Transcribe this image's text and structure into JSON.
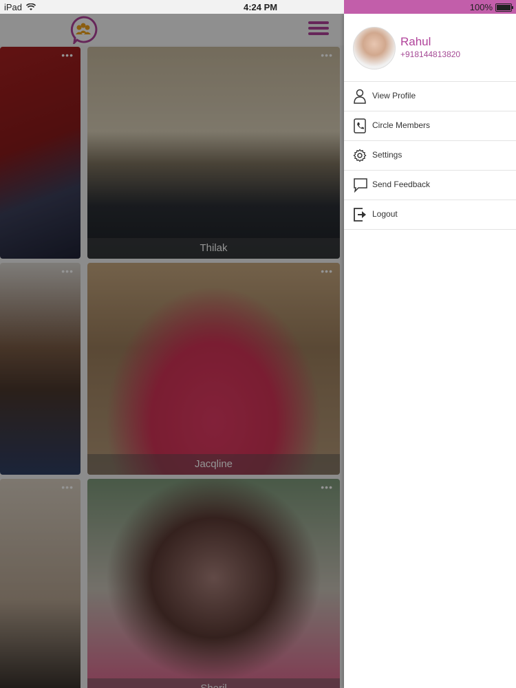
{
  "status_bar": {
    "device": "iPad",
    "time": "4:24 PM",
    "battery": "100%",
    "battery_level": 1.0
  },
  "grid": {
    "tiles": [
      {
        "name": ""
      },
      {
        "name": "Thilak"
      },
      {
        "name": ""
      },
      {
        "name": "Jacqline"
      },
      {
        "name": ""
      },
      {
        "name": "Sheril"
      }
    ],
    "more_label": "•••"
  },
  "drawer": {
    "profile": {
      "name": "Rahul",
      "phone": "+918144813820"
    },
    "items": [
      {
        "label": "View Profile",
        "icon": "person-icon"
      },
      {
        "label": "Circle Members",
        "icon": "phone-book-icon"
      },
      {
        "label": "Settings",
        "icon": "gear-icon"
      },
      {
        "label": "Send Feedback",
        "icon": "speech-bubble-icon"
      },
      {
        "label": "Logout",
        "icon": "logout-icon"
      }
    ]
  },
  "colors": {
    "accent": "#b0429a",
    "status_right": "#c25eaa"
  }
}
